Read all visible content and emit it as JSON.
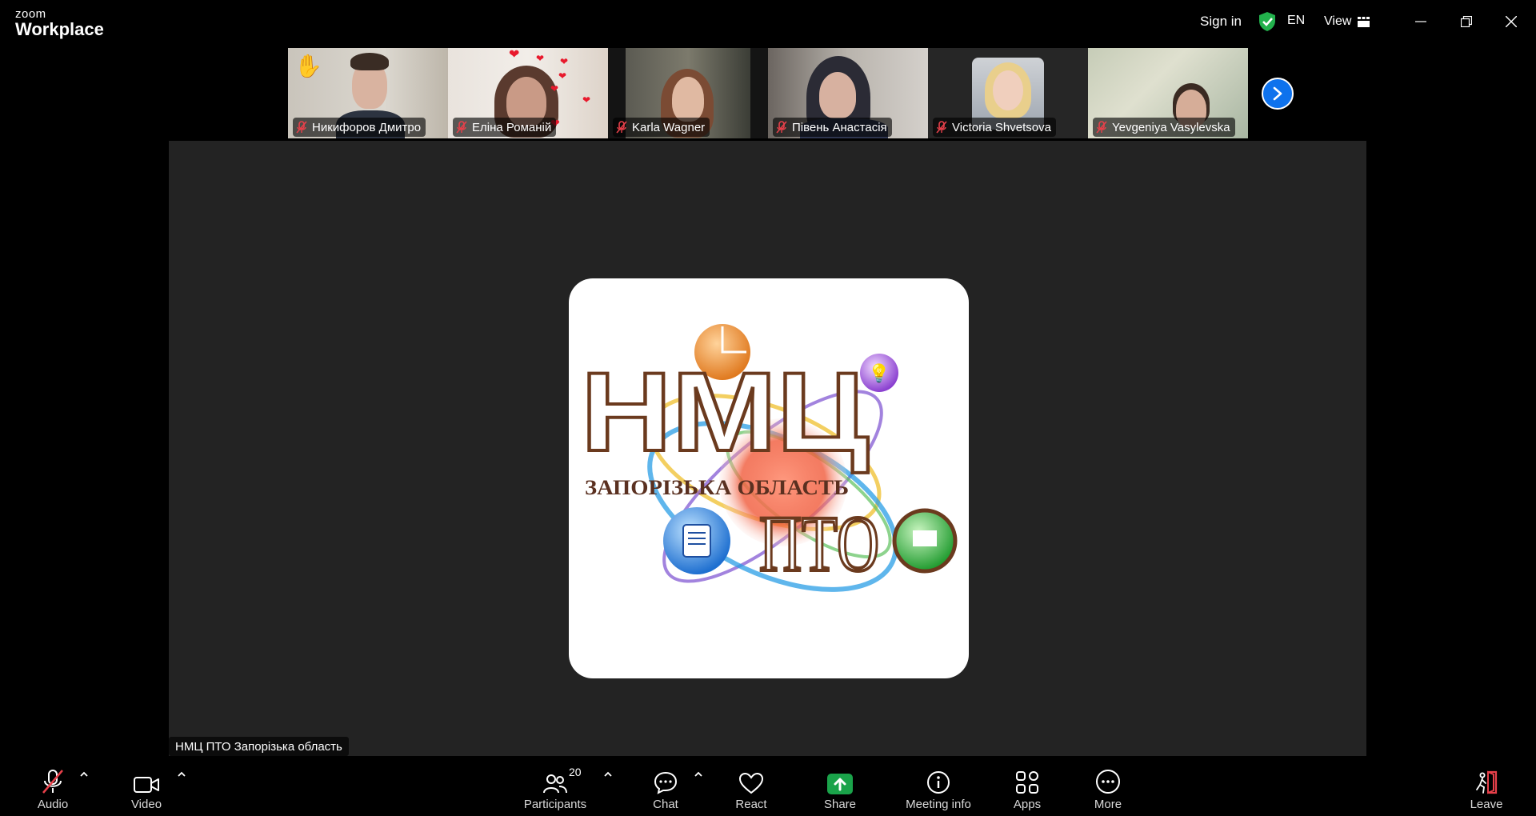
{
  "app": {
    "brand_small": "zoom",
    "brand_big": "Workplace",
    "sign_in": "Sign in",
    "language": "EN",
    "view_label": "View"
  },
  "participants_strip": [
    {
      "name": "Никифоров Дмитро",
      "muted": true,
      "hand_raised": true
    },
    {
      "name": "Еліна Романій",
      "muted": true
    },
    {
      "name": "Karla Wagner",
      "muted": true
    },
    {
      "name": "Півень Анастасія",
      "muted": true
    },
    {
      "name": "Victoria Shvetsova",
      "muted": true
    },
    {
      "name": "Yevgeniya Vasylevska",
      "muted": true
    }
  ],
  "stage": {
    "speaker_label": "НМЦ ПТО Запорізька область",
    "logo_text_main": "НМЦ",
    "logo_text_region": "ЗАПОРІЗЬКА ОБЛАСТЬ",
    "logo_text_sub": "ПТО"
  },
  "toolbar": {
    "audio": "Audio",
    "video": "Video",
    "participants": "Participants",
    "participants_count": "20",
    "chat": "Chat",
    "react": "React",
    "share": "Share",
    "meeting_info": "Meeting info",
    "apps": "Apps",
    "more": "More",
    "leave": "Leave"
  },
  "colors": {
    "accent": "#0e72ed",
    "share_green": "#1aa34a",
    "muted_red": "#e8404a",
    "shield_green": "#22b14c"
  }
}
